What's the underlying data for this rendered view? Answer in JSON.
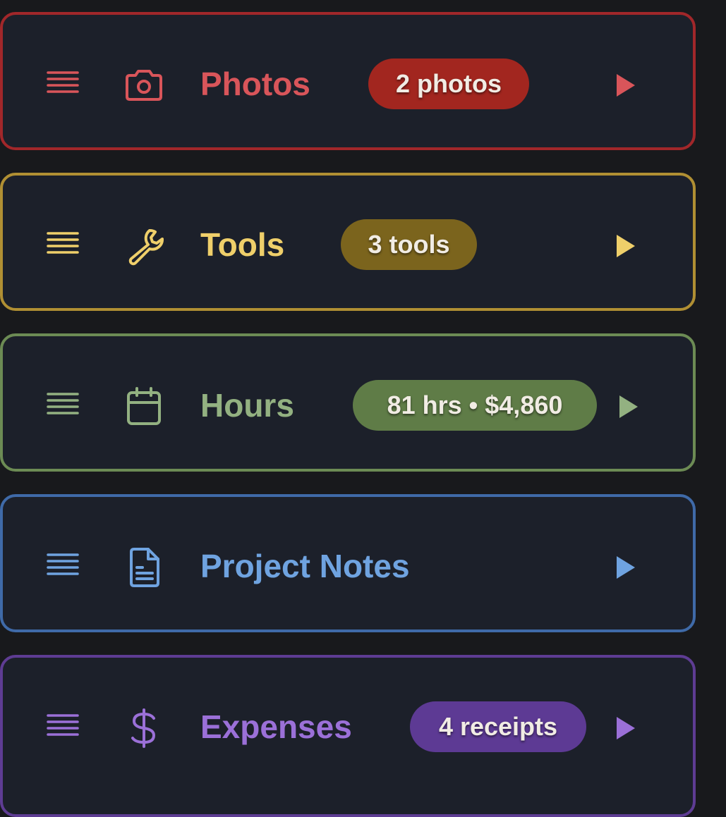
{
  "sections": [
    {
      "title": "Photos",
      "badge": "2 photos",
      "icon": "camera-icon",
      "color": "#d9555a",
      "border": "#a1272a",
      "badge_bg": "#a2261f"
    },
    {
      "title": "Tools",
      "badge": "3 tools",
      "icon": "wrench-icon",
      "color": "#efcf6a",
      "border": "#b08f33",
      "badge_bg": "#7b641d"
    },
    {
      "title": "Hours",
      "badge": "81 hrs • $4,860",
      "icon": "calendar-icon",
      "color": "#93b181",
      "border": "#6c8b54",
      "badge_bg": "#5f7c47"
    },
    {
      "title": "Project Notes",
      "badge": "",
      "icon": "document-icon",
      "color": "#6fa3e0",
      "border": "#3f6aa8",
      "badge_bg": ""
    },
    {
      "title": "Expenses",
      "badge": "4 receipts",
      "icon": "dollar-icon",
      "color": "#9b70d8",
      "border": "#5e3c93",
      "badge_bg": "#5d3a94"
    }
  ]
}
